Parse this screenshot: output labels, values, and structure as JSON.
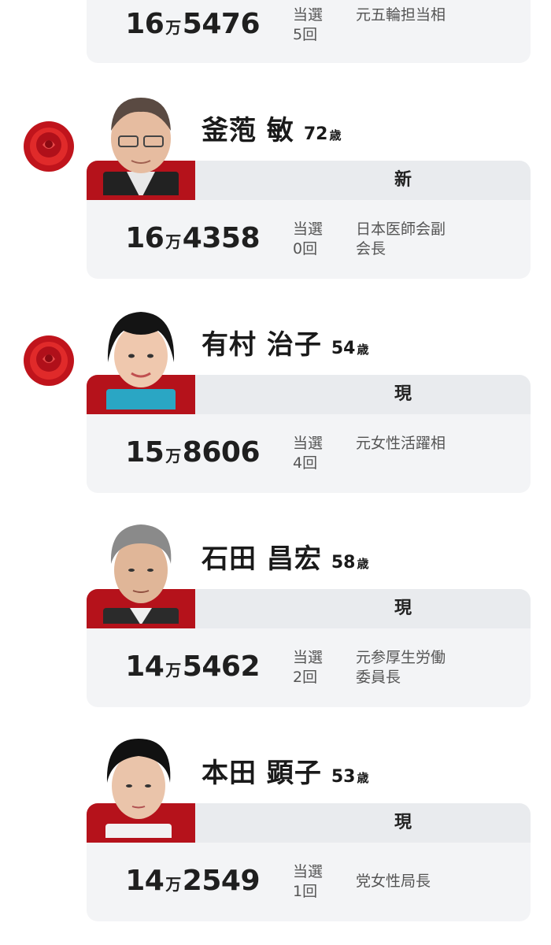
{
  "common": {
    "elect_label": "当選",
    "age_unit": "歳",
    "man_unit": "万"
  },
  "candidates": [
    {
      "name": "",
      "age": "",
      "status": "",
      "votes_man": "16",
      "votes_rest": "5476",
      "times": "5回",
      "note": "元五輪担当相",
      "winner": false
    },
    {
      "name": "釜萢 敏",
      "age": "72",
      "status": "新",
      "votes_man": "16",
      "votes_rest": "4358",
      "times": "0回",
      "note": "日本医師会副会長",
      "winner": true
    },
    {
      "name": "有村 治子",
      "age": "54",
      "status": "現",
      "votes_man": "15",
      "votes_rest": "8606",
      "times": "4回",
      "note": "元女性活躍相",
      "winner": true
    },
    {
      "name": "石田 昌宏",
      "age": "58",
      "status": "現",
      "votes_man": "14",
      "votes_rest": "5462",
      "times": "2回",
      "note": "元参厚生労働委員長",
      "winner": false
    },
    {
      "name": "本田 顕子",
      "age": "53",
      "status": "現",
      "votes_man": "14",
      "votes_rest": "2549",
      "times": "1回",
      "note": "党女性局長",
      "winner": false
    }
  ],
  "colors": {
    "accent_red": "#b5121b",
    "card_bg": "#f3f4f6",
    "status_bg": "#e9ebee"
  }
}
